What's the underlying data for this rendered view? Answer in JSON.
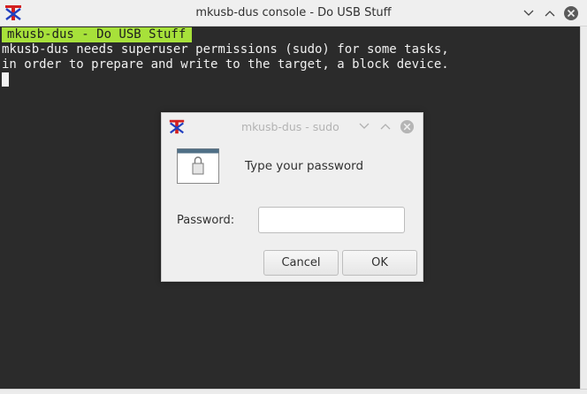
{
  "window": {
    "title": "mkusb-dus console - Do USB Stuff",
    "icon": "mkusb-logo-icon",
    "controls": [
      "minimize-icon",
      "maximize-icon",
      "close-icon"
    ]
  },
  "terminal": {
    "header": " mkusb-dus - Do USB Stuff ",
    "lines": [
      "mkusb-dus needs superuser permissions (sudo) for some tasks,",
      "in order to prepare and write to the target, a block device."
    ],
    "header_bg": "#a7e13a"
  },
  "dialog": {
    "title": "mkusb-dus - sudo",
    "icon": "mkusb-logo-icon",
    "prompt": "Type your password",
    "password_label": "Password:",
    "password_value": "",
    "cancel_label": "Cancel",
    "ok_label": "OK"
  }
}
